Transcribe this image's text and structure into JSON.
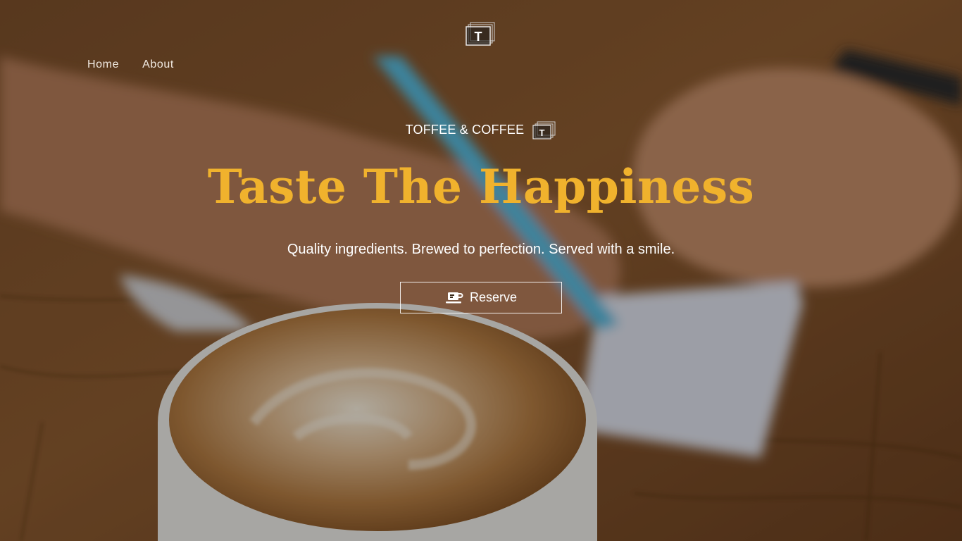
{
  "nav": {
    "items": [
      {
        "label": "Home"
      },
      {
        "label": "About"
      }
    ]
  },
  "hero": {
    "brand": "TOFFEE & COFFEE",
    "headline": "Taste The Happiness",
    "tagline": "Quality ingredients. Brewed to perfection. Served with a smile.",
    "reserve_label": "Reserve"
  },
  "logo_letter": "T",
  "icons": {
    "top_logo": "toffee-logo-icon",
    "brand_mark": "toffee-logo-icon",
    "reserve": "coffee-cup-icon"
  },
  "colors": {
    "headline": "#f0b22d",
    "text": "#ffffff",
    "nav_text": "#f2ebe3"
  }
}
